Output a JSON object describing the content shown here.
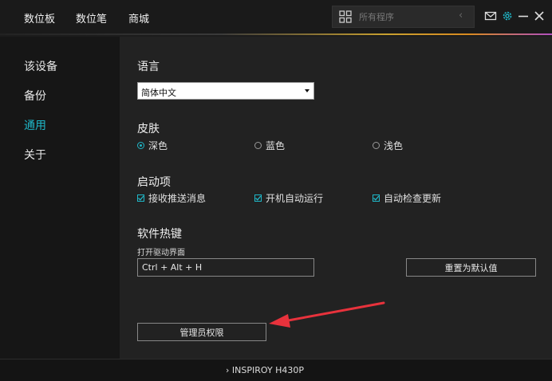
{
  "nav": {
    "tabs": [
      {
        "label": "数位板"
      },
      {
        "label": "数位笔"
      },
      {
        "label": "商城"
      }
    ],
    "search_placeholder": "所有程序",
    "back_glyph": "‹"
  },
  "sidebar": {
    "items": [
      {
        "label": "该设备",
        "active": false
      },
      {
        "label": "备份",
        "active": false
      },
      {
        "label": "通用",
        "active": true
      },
      {
        "label": "关于",
        "active": false
      }
    ]
  },
  "settings": {
    "language": {
      "title": "语言",
      "selected": "简体中文"
    },
    "skin": {
      "title": "皮肤",
      "options": [
        {
          "label": "深色",
          "selected": true
        },
        {
          "label": "蓝色",
          "selected": false
        },
        {
          "label": "浅色",
          "selected": false
        }
      ]
    },
    "startup": {
      "title": "启动项",
      "options": [
        {
          "label": "接收推送消息",
          "checked": true
        },
        {
          "label": "开机自动运行",
          "checked": true
        },
        {
          "label": "自动检查更新",
          "checked": true
        }
      ]
    },
    "hotkeys": {
      "title": "软件热键",
      "label": "打开驱动界面",
      "value": "Ctrl + Alt + H",
      "reset_label": "重置为默认值"
    },
    "admin_label": "管理员权限"
  },
  "status": {
    "device_name": "INSPIROY H430P",
    "chevron": "›"
  },
  "colors": {
    "accent": "#1fb7c8",
    "annotation_arrow": "#e8323c"
  }
}
